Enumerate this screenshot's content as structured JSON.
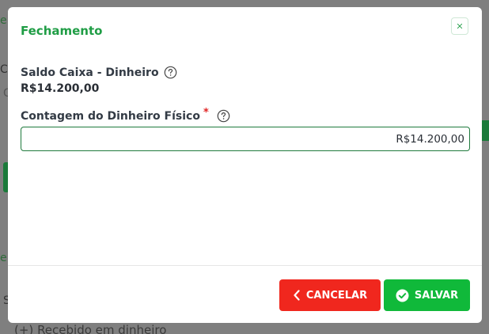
{
  "modal": {
    "title": "Fechamento",
    "close_icon": "close-icon"
  },
  "cash_balance": {
    "label": "Saldo Caixa - Dinheiro",
    "value": "R$14.200,00",
    "help_icon": "help-circle-icon"
  },
  "cash_count": {
    "label": "Contagem do Dinheiro Físico",
    "required_mark": "*",
    "value": "R$14.200,00",
    "help_icon": "help-circle-icon"
  },
  "footer": {
    "cancel_label": "CANCELAR",
    "save_label": "SALVAR"
  },
  "background": {
    "row_label": "Recebido em dinheiro",
    "row_prefix": "(+)"
  },
  "colors": {
    "title": "#1f9d45",
    "cancel": "#f0271e",
    "save": "#10b93a",
    "input_border": "#1f7a3d",
    "required": "#e02424"
  }
}
